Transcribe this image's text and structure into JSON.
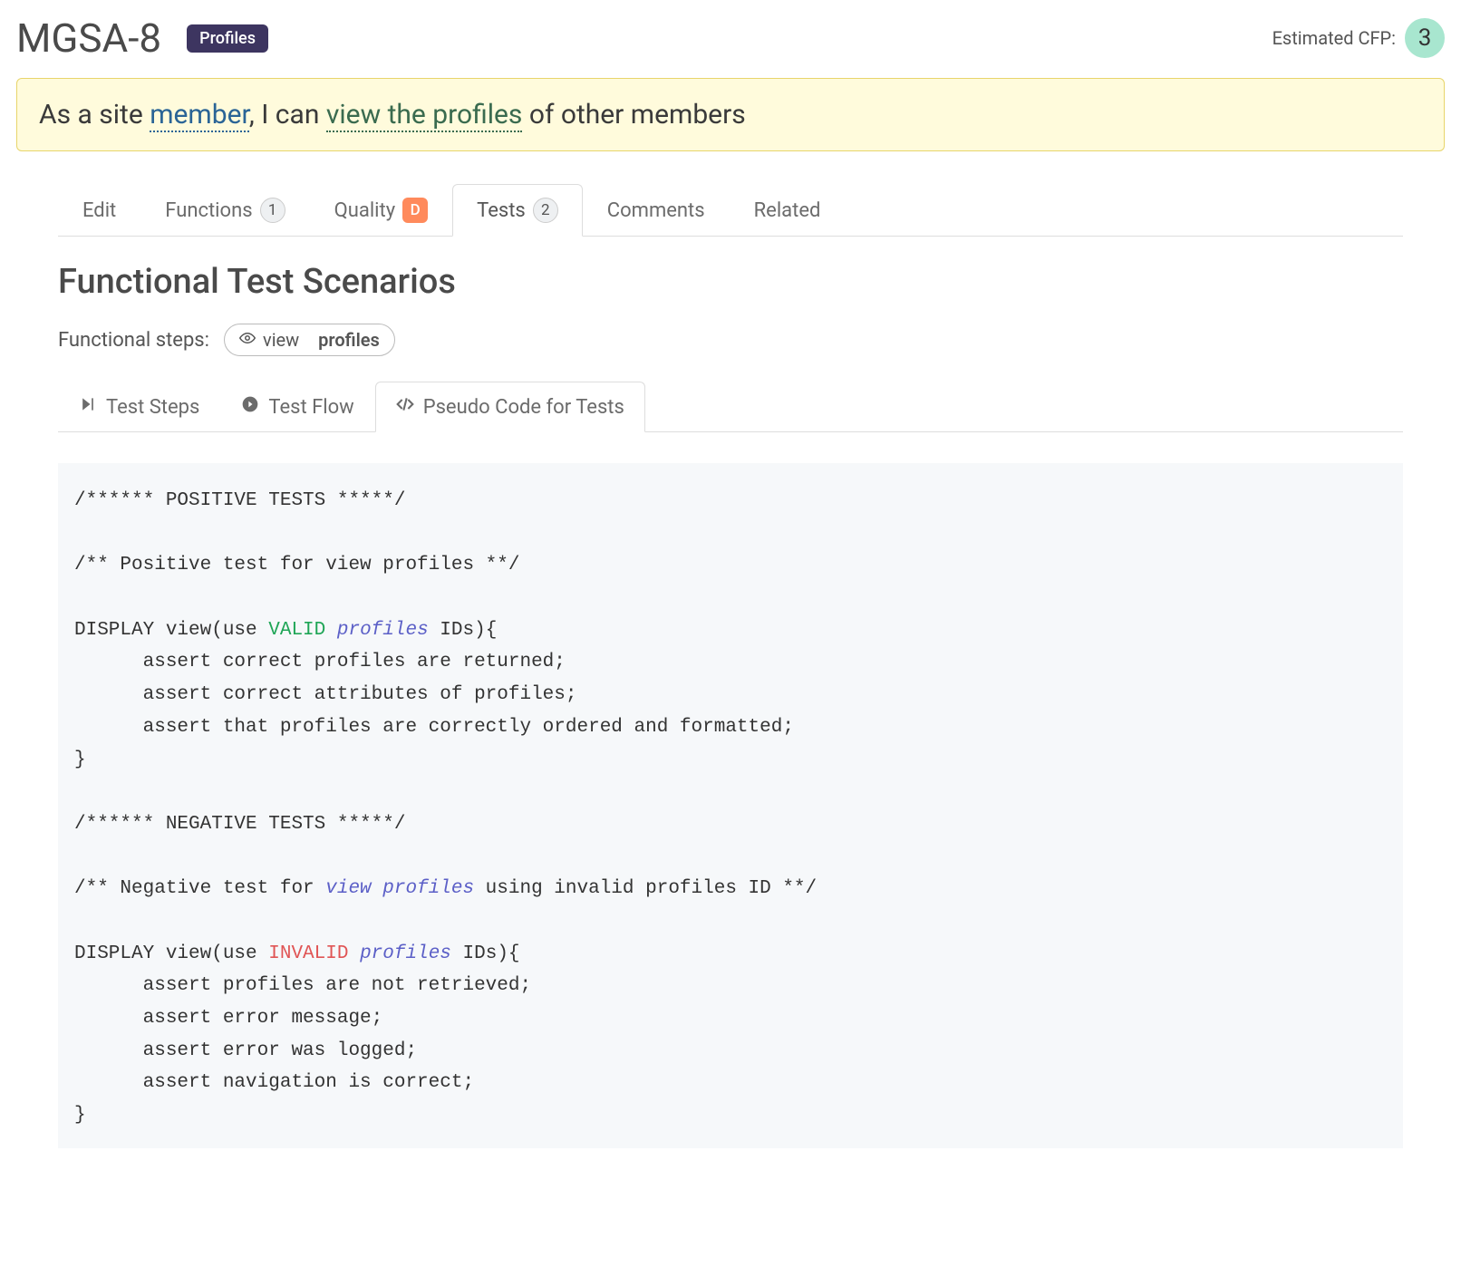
{
  "header": {
    "title": "MGSA-8",
    "badge": "Profiles",
    "cfp_label": "Estimated CFP:",
    "cfp_value": "3"
  },
  "story": {
    "prefix": "As a site ",
    "role": "member",
    "mid": ", I can ",
    "action": "view the profiles",
    "suffix": " of other members"
  },
  "tabs": {
    "edit": "Edit",
    "functions": "Functions",
    "functions_count": "1",
    "quality": "Quality",
    "quality_grade": "D",
    "tests": "Tests",
    "tests_count": "2",
    "comments": "Comments",
    "related": "Related"
  },
  "section": {
    "title": "Functional Test Scenarios",
    "steps_label": "Functional steps:",
    "step_chip_action": "view",
    "step_chip_object": "profiles"
  },
  "subtabs": {
    "steps": "Test Steps",
    "flow": "Test Flow",
    "pseudo": "Pseudo Code for Tests"
  },
  "code": {
    "l1": "/****** POSITIVE TESTS *****/",
    "l2": "/** Positive test for view profiles **/",
    "l3a": "DISPLAY view(use ",
    "l3_valid": "VALID",
    "l3_sp": " ",
    "l3_profiles": "profiles",
    "l3b": " IDs){",
    "l4": "      assert correct profiles are returned;",
    "l5": "      assert correct attributes of profiles;",
    "l6": "      assert that profiles are correctly ordered and formatted;",
    "l7": "}",
    "l8": "/****** NEGATIVE TESTS *****/",
    "l9a": "/** Negative test for ",
    "l9_em": "view profiles",
    "l9b": " using invalid profiles ID **/",
    "l10a": "DISPLAY view(use ",
    "l10_invalid": "INVALID",
    "l10_sp": " ",
    "l10_profiles": "profiles",
    "l10b": " IDs){",
    "l11": "      assert profiles are not retrieved;",
    "l12": "      assert error message;",
    "l13": "      assert error was logged;",
    "l14": "      assert navigation is correct;",
    "l15": "}"
  }
}
